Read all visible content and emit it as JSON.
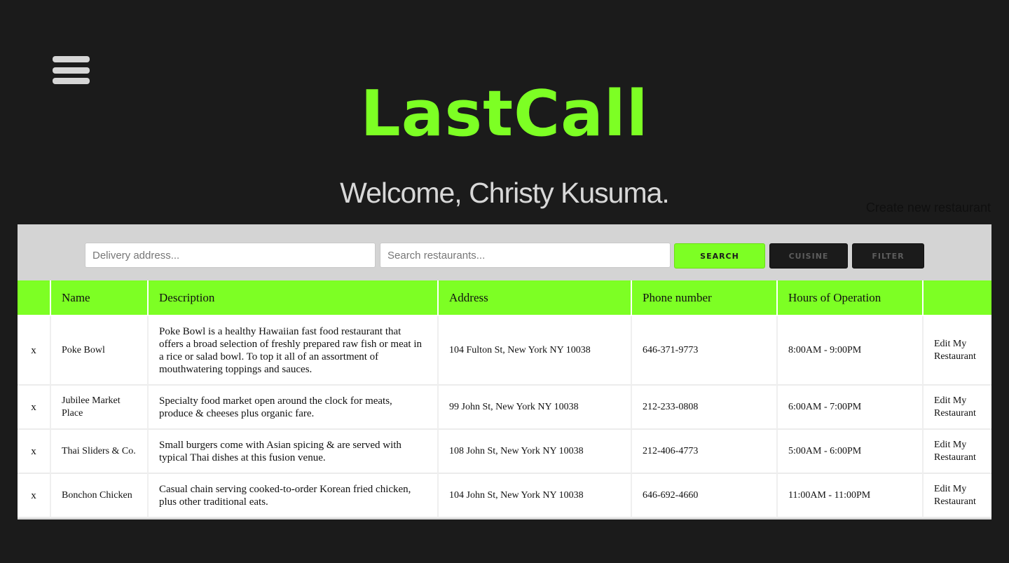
{
  "header": {
    "logo": "LastCall",
    "welcome": "Welcome, Christy Kusuma.",
    "create_link": "Create new restaurant"
  },
  "search": {
    "address_placeholder": "Delivery address...",
    "restaurant_placeholder": "Search restaurants...",
    "search_label": "SEARCH",
    "cuisine_label": "CUISINE",
    "filter_label": "FILTER"
  },
  "colors": {
    "accent": "#7dff24",
    "background": "#1b1b1b",
    "panel": "#d4d4d4"
  },
  "table": {
    "headers": [
      "",
      "Name",
      "Description",
      "Address",
      "Phone number",
      "Hours of Operation",
      ""
    ],
    "rows": [
      {
        "delete": "x",
        "name": "Poke Bowl",
        "description": "Poke Bowl is a healthy Hawaiian fast food restaurant that offers a broad selection of freshly prepared raw fish or meat in a rice or salad bowl. To top it all of an assortment of mouthwatering toppings and sauces.",
        "address": "104 Fulton St, New York NY 10038",
        "phone": "646-371-9773",
        "hours": "8:00AM - 9:00PM",
        "edit": "Edit My Restaurant"
      },
      {
        "delete": "x",
        "name": "Jubilee Market Place",
        "description": "Specialty food market open around the clock for meats, produce & cheeses plus organic fare.",
        "address": "99 John St, New York NY 10038",
        "phone": "212-233-0808",
        "hours": "6:00AM - 7:00PM",
        "edit": "Edit My Restaurant"
      },
      {
        "delete": "x",
        "name": "Thai Sliders & Co.",
        "description": "Small burgers come with Asian spicing & are served with typical Thai dishes at this fusion venue.",
        "address": "108 John St, New York NY 10038",
        "phone": "212-406-4773",
        "hours": "5:00AM - 6:00PM",
        "edit": "Edit My Restaurant"
      },
      {
        "delete": "x",
        "name": "Bonchon Chicken",
        "description": "Casual chain serving cooked-to-order Korean fried chicken, plus other traditional eats.",
        "address": "104 John St, New York NY 10038",
        "phone": "646-692-4660",
        "hours": "11:00AM - 11:00PM",
        "edit": "Edit My Restaurant"
      }
    ]
  }
}
